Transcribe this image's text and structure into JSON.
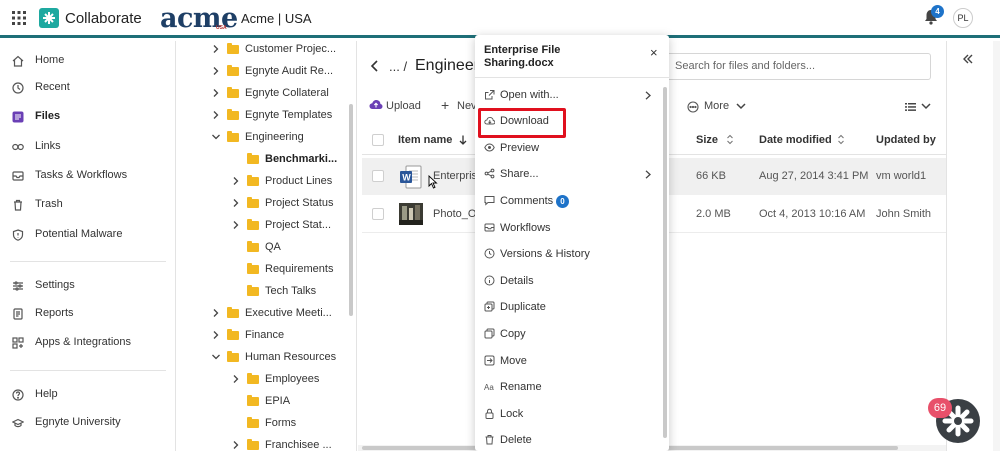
{
  "header": {
    "app_name": "Collaborate",
    "brand_logo": "acme",
    "brand_logo_sub": "USA",
    "org_name": "Acme | USA",
    "notification_count": "4",
    "avatar_initials": "PL",
    "accent_color": "#1e6f78"
  },
  "nav": {
    "items": [
      {
        "label": "Home",
        "icon": "home-icon"
      },
      {
        "label": "Recent",
        "icon": "clock-icon"
      },
      {
        "label": "Files",
        "icon": "files-icon"
      },
      {
        "label": "Links",
        "icon": "link-icon"
      },
      {
        "label": "Tasks & Workflows",
        "icon": "tasks-icon"
      },
      {
        "label": "Trash",
        "icon": "trash-icon"
      },
      {
        "label": "Potential Malware",
        "icon": "shield-icon"
      },
      {
        "label": "Settings",
        "icon": "sliders-icon"
      },
      {
        "label": "Reports",
        "icon": "report-icon"
      },
      {
        "label": "Apps & Integrations",
        "icon": "apps-icon"
      },
      {
        "label": "Help",
        "icon": "help-icon"
      },
      {
        "label": "Egnyte University",
        "icon": "graduation-icon"
      }
    ]
  },
  "tree": {
    "items": [
      {
        "label": "Customer Projec..."
      },
      {
        "label": "Egnyte Audit Re..."
      },
      {
        "label": "Egnyte Collateral"
      },
      {
        "label": "Egnyte Templates"
      },
      {
        "label": "Engineering"
      },
      {
        "label": "Benchmarki..."
      },
      {
        "label": "Product Lines"
      },
      {
        "label": "Project Status"
      },
      {
        "label": "Project Stat..."
      },
      {
        "label": "QA"
      },
      {
        "label": "Requirements"
      },
      {
        "label": "Tech Talks"
      },
      {
        "label": "Executive Meeti..."
      },
      {
        "label": "Finance"
      },
      {
        "label": "Human Resources"
      },
      {
        "label": "Employees"
      },
      {
        "label": "EPIA"
      },
      {
        "label": "Forms"
      },
      {
        "label": "Franchisee ..."
      }
    ]
  },
  "main": {
    "breadcrumb_ellipsis": "... /",
    "breadcrumb_current": "Engineer",
    "search_placeholder": "Search for files and folders...",
    "toolbar": {
      "upload": "Upload",
      "new": "Nev",
      "more": "More"
    },
    "columns": {
      "name": "Item name",
      "size": "Size",
      "date": "Date modified",
      "updated": "Updated by"
    },
    "rows": [
      {
        "name": "Enterprise",
        "size": "66 KB",
        "date": "Aug 27, 2014 3:41 PM",
        "updated": "vm world1"
      },
      {
        "name": "Photo_O",
        "size": "2.0 MB",
        "date": "Oct 4, 2013 10:16 AM",
        "updated": "John Smith"
      }
    ]
  },
  "context_menu": {
    "title": "Enterprise File Sharing.docx",
    "items": [
      {
        "label": "Open with...",
        "icon": "open-external-icon"
      },
      {
        "label": "Download",
        "icon": "cloud-download-icon"
      },
      {
        "label": "Preview",
        "icon": "eye-icon"
      },
      {
        "label": "Share...",
        "icon": "share-icon"
      },
      {
        "label": "Comments",
        "icon": "comment-icon"
      },
      {
        "label": "Workflows",
        "icon": "workflow-icon"
      },
      {
        "label": "Versions & History",
        "icon": "history-icon"
      },
      {
        "label": "Details",
        "icon": "info-icon"
      },
      {
        "label": "Duplicate",
        "icon": "duplicate-icon"
      },
      {
        "label": "Copy",
        "icon": "copy-icon"
      },
      {
        "label": "Move",
        "icon": "move-icon"
      },
      {
        "label": "Rename",
        "icon": "rename-icon"
      },
      {
        "label": "Lock",
        "icon": "lock-icon"
      },
      {
        "label": "Delete",
        "icon": "trash-icon"
      }
    ],
    "comments_count": "0",
    "highlight_color": "#e0101e"
  },
  "chat": {
    "unread_count": "69"
  }
}
